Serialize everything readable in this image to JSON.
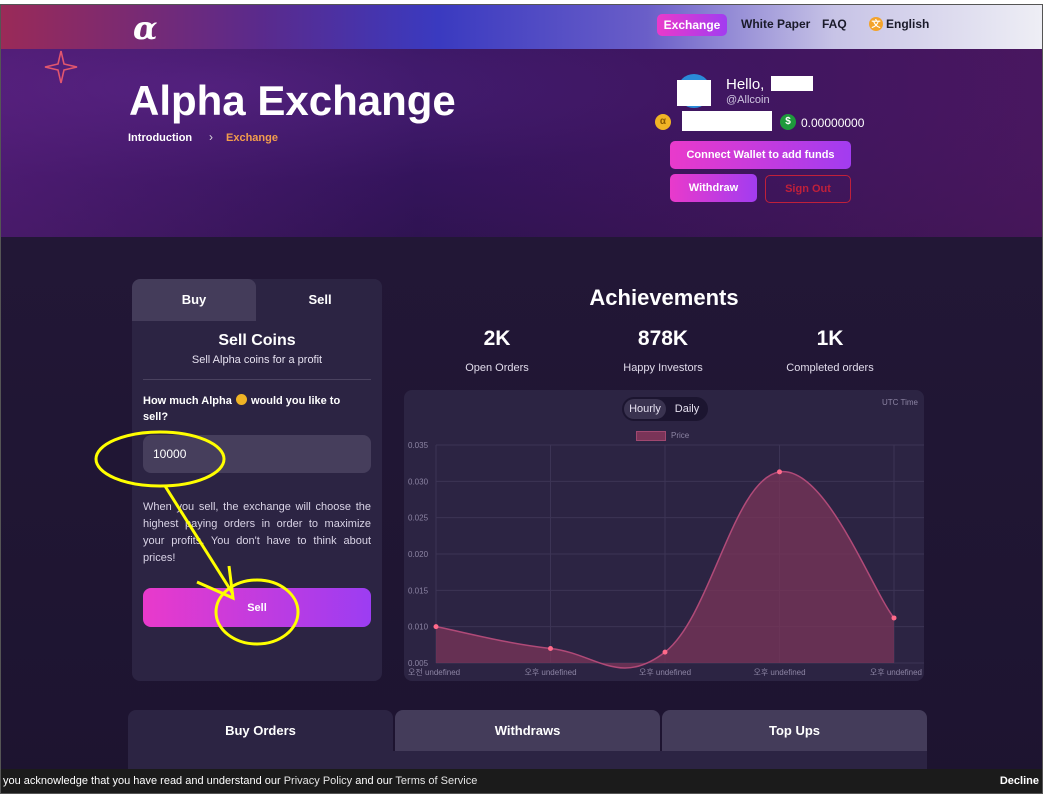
{
  "colors": {
    "accent_start": "#e93acb",
    "accent_end": "#a23cf0",
    "danger": "#c0203a",
    "annotation": "#ffff00",
    "chart_fill": "#7a3458"
  },
  "nav": {
    "logo": "α",
    "exchange": "Exchange",
    "white_paper": "White Paper",
    "faq": "FAQ",
    "language": "English"
  },
  "hero": {
    "title": "Alpha Exchange",
    "breadcrumb": [
      "Introduction",
      "Exchange"
    ],
    "hello": "Hello,",
    "handle": "@Allcoin",
    "usd_balance": "0.00000000",
    "connect_wallet": "Connect Wallet to add funds",
    "withdraw": "Withdraw",
    "sign_out": "Sign Out"
  },
  "trade": {
    "tabs": [
      "Buy",
      "Sell"
    ],
    "active_tab": "Sell",
    "title": "Sell Coins",
    "subtitle": "Sell Alpha coins for a profit",
    "question_start": "How much Alpha",
    "question_end": "would you like to sell?",
    "amount_value": "10000",
    "description": "When you sell, the exchange will choose the highest paying orders in order to maximize your profits. You don't have to think about prices!",
    "sell_button": "Sell"
  },
  "achievements": {
    "title": "Achievements",
    "stats": [
      {
        "value": "2K",
        "label": "Open Orders"
      },
      {
        "value": "878K",
        "label": "Happy Investors"
      },
      {
        "value": "1K",
        "label": "Completed orders"
      }
    ]
  },
  "chart": {
    "toggle": [
      "Hourly",
      "Daily"
    ],
    "active_toggle": "Hourly",
    "utc_label": "UTC Time",
    "legend": "Price"
  },
  "chart_data": {
    "type": "area",
    "title": "",
    "xlabel": "",
    "ylabel": "",
    "x": [
      "오전 undefined",
      "오후 undefined",
      "오후 undefined",
      "오후 undefined",
      "오후 undefined"
    ],
    "series": [
      {
        "name": "Price",
        "values": [
          0.01,
          0.007,
          0.0065,
          0.0313,
          0.0112
        ]
      }
    ],
    "ylim": [
      0.005,
      0.035
    ],
    "yticks": [
      "0.005",
      "0.010",
      "0.015",
      "0.020",
      "0.025",
      "0.030",
      "0.035"
    ],
    "grid": true,
    "legend_position": "top"
  },
  "bottom_tabs": [
    "Buy Orders",
    "Withdraws",
    "Top Ups"
  ],
  "cookie": {
    "text1": "you acknowledge that you have read and understand our",
    "privacy": "Privacy Policy",
    "text2": "and our",
    "terms": "Terms of Service",
    "decline": "Decline"
  }
}
